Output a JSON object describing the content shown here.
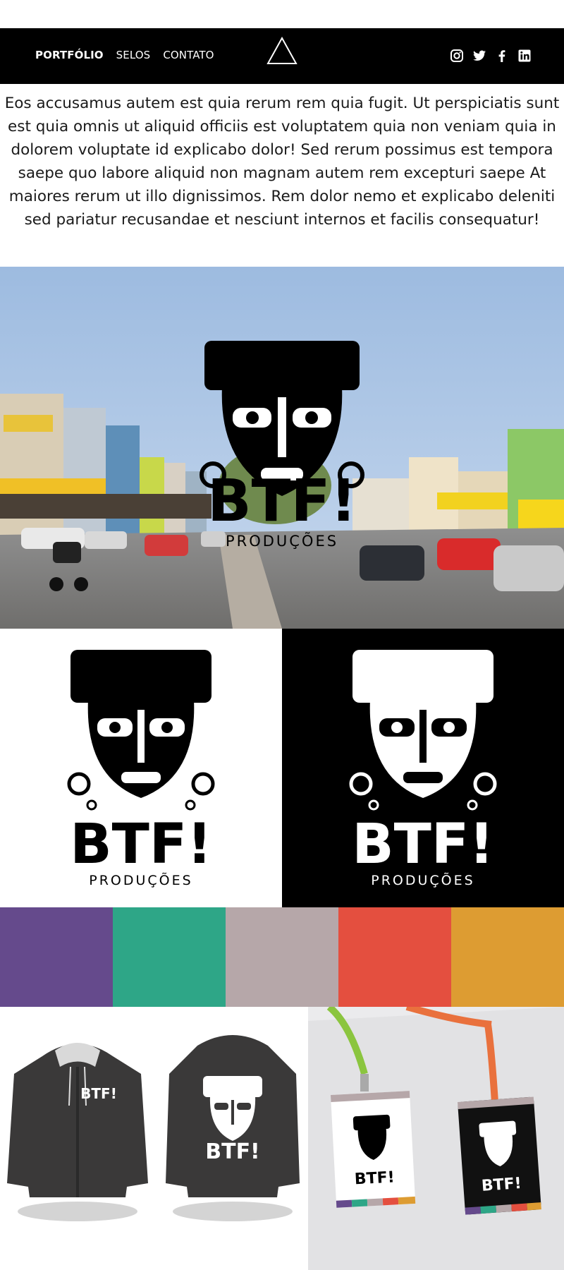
{
  "nav": {
    "links": [
      {
        "label": "PORTFÓLIO",
        "active": true
      },
      {
        "label": "SELOS",
        "active": false
      },
      {
        "label": "CONTATO",
        "active": false
      }
    ],
    "logo_icon": "triangle-outline-icon",
    "social_icons": [
      "instagram-icon",
      "twitter-icon",
      "facebook-icon",
      "linkedin-icon"
    ]
  },
  "intro": {
    "text": "Eos accusamus autem est quia rerum rem quia fugit. Ut perspiciatis sunt est quia omnis ut aliquid officiis est voluptatem quia non veniam quia in dolorem voluptate id explicabo dolor! Sed rerum possimus est tempora saepe quo labore aliquid non magnam autem rem excepturi saepe At maiores rerum ut illo dignissimos. Rem dolor nemo et explicabo deleniti sed pariatur recusandae et nesciunt internos et facilis consequatur!"
  },
  "brand": {
    "name": "BTF!",
    "subtitle": "PRODUÇÕES"
  },
  "palette": {
    "colors": [
      "#654a8c",
      "#2ea687",
      "#b6a7a9",
      "#e44f3f",
      "#dd9c32"
    ]
  },
  "colors": {
    "nav_bg": "#000000",
    "hoodie": "#3a3939",
    "lanyard_green": "#8bc53f",
    "lanyard_orange": "#e9713d"
  }
}
